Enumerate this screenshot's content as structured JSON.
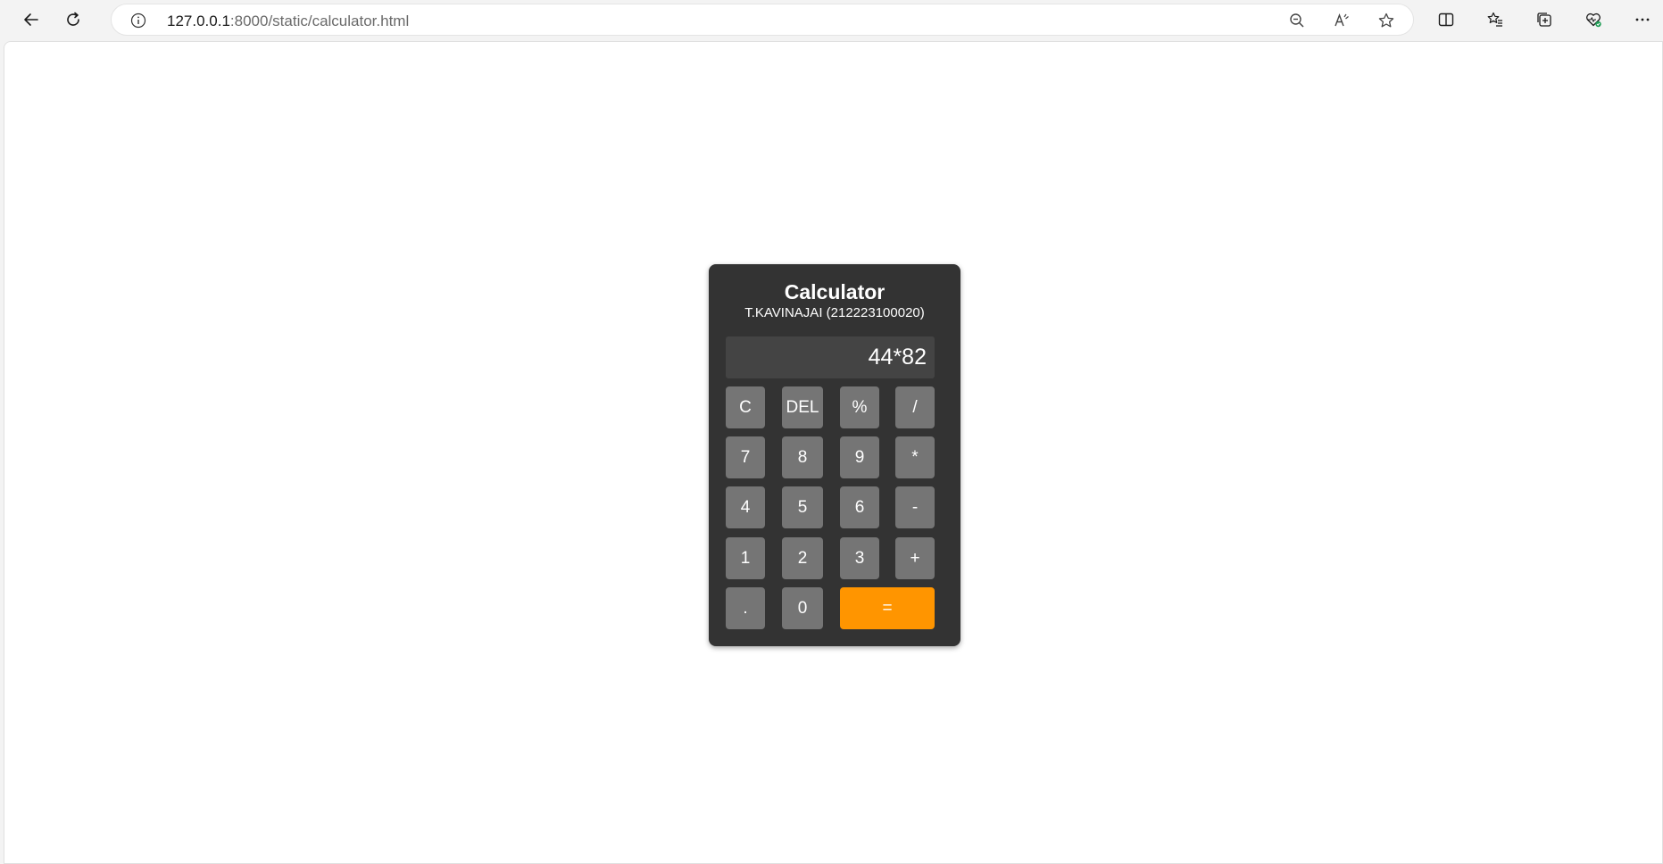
{
  "browser": {
    "url_host": "127.0.0.1",
    "url_path": ":8000/static/calculator.html",
    "icons": {
      "back": "back-arrow-icon",
      "refresh": "refresh-icon",
      "info": "info-icon",
      "zoom": "zoom-out-icon",
      "read_aloud": "read-aloud-icon",
      "favorite": "star-icon",
      "split": "split-screen-icon",
      "favorites": "favorites-list-icon",
      "collections": "collections-icon",
      "health": "browser-essentials-icon",
      "more": "more-icon"
    }
  },
  "calculator": {
    "title": "Calculator",
    "subtitle": "T.KAVINAJAI (212223100020)",
    "display": "44*82",
    "keys": {
      "clear": "C",
      "del": "DEL",
      "percent": "%",
      "divide": "/",
      "seven": "7",
      "eight": "8",
      "nine": "9",
      "multiply": "*",
      "four": "4",
      "five": "5",
      "six": "6",
      "minus": "-",
      "one": "1",
      "two": "2",
      "three": "3",
      "plus": "+",
      "dot": ".",
      "zero": "0",
      "equals": "="
    },
    "colors": {
      "body": "#333333",
      "display": "#444444",
      "key": "#757575",
      "equals": "#ff9500"
    }
  }
}
